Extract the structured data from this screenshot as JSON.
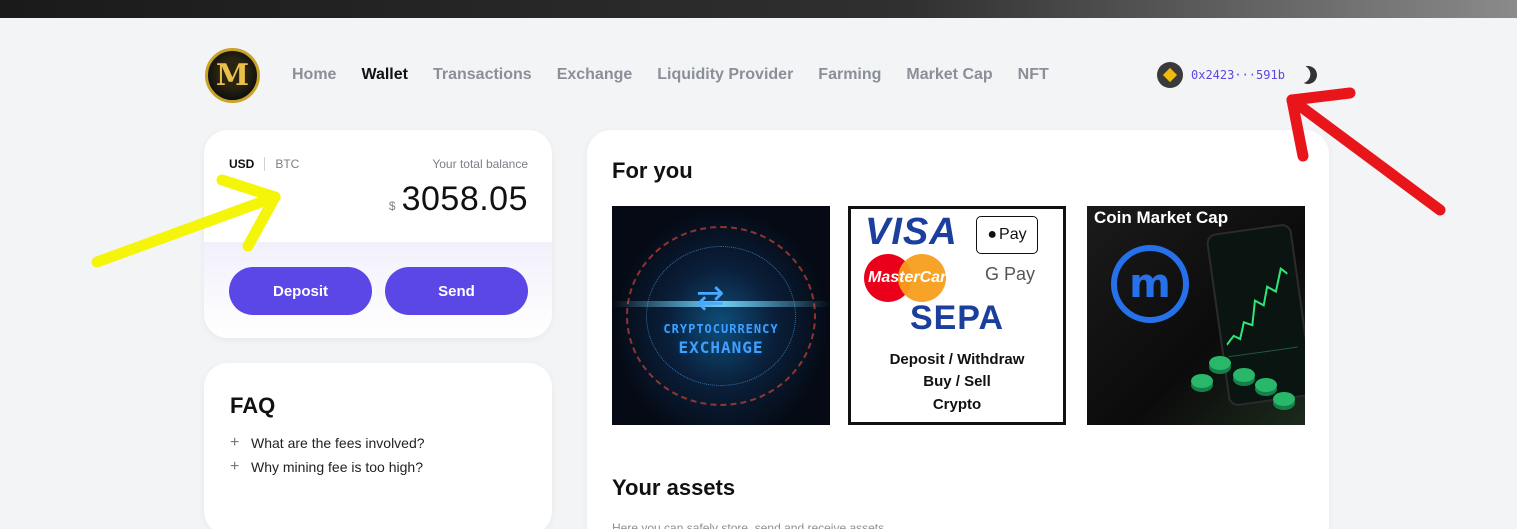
{
  "nav": {
    "logo_letter": "M",
    "links": [
      {
        "label": "Home",
        "active": false
      },
      {
        "label": "Wallet",
        "active": true
      },
      {
        "label": "Transactions",
        "active": false
      },
      {
        "label": "Exchange",
        "active": false
      },
      {
        "label": "Liquidity Provider",
        "active": false
      },
      {
        "label": "Farming",
        "active": false
      },
      {
        "label": "Market Cap",
        "active": false
      },
      {
        "label": "NFT",
        "active": false
      }
    ],
    "wallet_address": "0x2423···591b",
    "wallet_icon": "binance-icon",
    "theme_icon": "moon-icon"
  },
  "balance": {
    "currency_options": [
      "USD",
      "BTC"
    ],
    "selected_currency": "USD",
    "label": "Your total balance",
    "symbol": "$",
    "amount": "3058.05",
    "deposit_label": "Deposit",
    "send_label": "Send"
  },
  "faq": {
    "title": "FAQ",
    "items": [
      "What are the fees involved?",
      "Why mining fee is too high?"
    ]
  },
  "for_you": {
    "title": "For you",
    "tiles": [
      {
        "name": "crypto-exchange",
        "lines": [
          "CRYPTOCURRENCY",
          "EXCHANGE"
        ]
      },
      {
        "name": "payment-methods",
        "brands": [
          "VISA",
          "Pay",
          "MasterCard",
          "G Pay",
          "SEPA"
        ],
        "lines": [
          "Deposit / Withdraw",
          "Buy / Sell",
          "Crypto"
        ]
      },
      {
        "name": "coin-market-cap",
        "title": "Coin Market Cap"
      }
    ]
  },
  "assets": {
    "title": "Your assets",
    "subtitle": "Here you can safely store, send and receive assets"
  },
  "colors": {
    "accent": "#5b46e6",
    "annotation_yellow": "#f5f50a",
    "annotation_red": "#e8161b"
  }
}
